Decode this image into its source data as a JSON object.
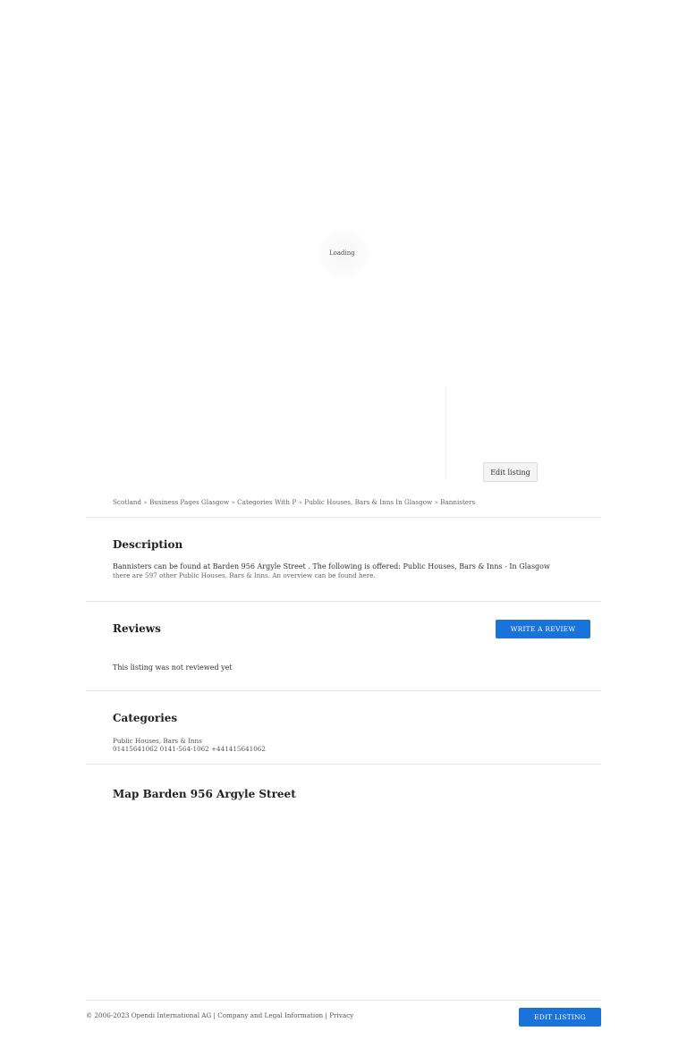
{
  "loader": {
    "text": "Loading"
  },
  "header": {
    "edit_listing_label": "Edit listing"
  },
  "breadcrumb": {
    "items": [
      "Scotland",
      "Business Pages Glasgow",
      "Categories With P",
      "Public Houses, Bars & Inns In Glasgow",
      "Bannisters"
    ],
    "separator": "»"
  },
  "description": {
    "title": "Description",
    "line1": "Bannisters can be found at Barden 956 Argyle Street . The following is offered: Public Houses, Bars & Inns - In Glasgow",
    "line2": "there are 597 other Public Houses, Bars & Inns. An overview can be found here."
  },
  "reviews": {
    "title": "Reviews",
    "write_review_label": "WRITE A REVIEW",
    "empty_text": "This listing was not reviewed yet"
  },
  "categories": {
    "title": "Categories",
    "items": [
      "Public Houses, Bars & Inns"
    ],
    "phones": "01415641062 0141-564-1062 +441415641062"
  },
  "map": {
    "title": "Map Barden 956 Argyle Street"
  },
  "footer": {
    "copyright": "© 2006-2023 Opendi International AG | Company and",
    "legal_label": "Legal Information",
    "divider": "|",
    "privacy_label": "Privacy",
    "edit_listing_label": "EDIT LISTING"
  }
}
